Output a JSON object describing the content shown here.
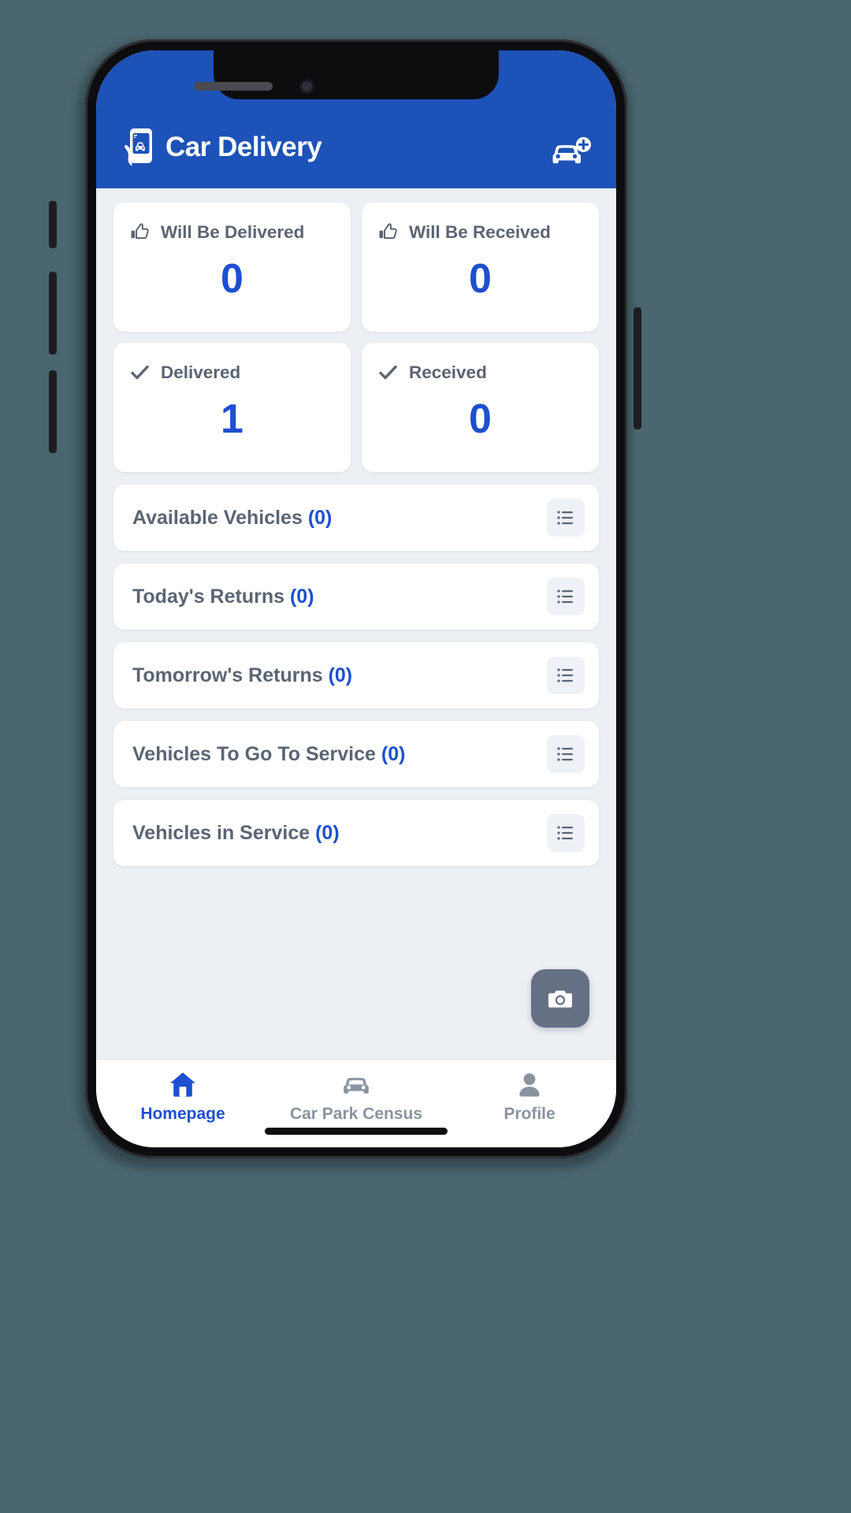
{
  "app": {
    "title": "Car Delivery",
    "logo_icon": "hand-holding-phone-car-icon",
    "add_vehicle_icon": "car-plus-icon",
    "header_color": "#1d52b8",
    "accent_color": "#1d4fd0",
    "screen_bg": "#eceff3"
  },
  "stats": [
    {
      "label": "Will Be Delivered",
      "value": "0",
      "icon": "thumbs-up-icon"
    },
    {
      "label": "Will Be Received",
      "value": "0",
      "icon": "thumbs-up-icon"
    },
    {
      "label": "Delivered",
      "value": "1",
      "icon": "check-icon"
    },
    {
      "label": "Received",
      "value": "0",
      "icon": "check-icon"
    }
  ],
  "lists": [
    {
      "title": "Available Vehicles",
      "count": "(0)",
      "icon": "list-icon"
    },
    {
      "title": "Today's Returns",
      "count": "(0)",
      "icon": "list-icon"
    },
    {
      "title": "Tomorrow's Returns",
      "count": "(0)",
      "icon": "list-icon"
    },
    {
      "title": "Vehicles To Go To Service",
      "count": "(0)",
      "icon": "list-icon"
    },
    {
      "title": "Vehicles in Service",
      "count": "(0)",
      "icon": "list-icon"
    }
  ],
  "fab": {
    "icon": "camera-icon",
    "color": "#667085"
  },
  "tabs": [
    {
      "label": "Homepage",
      "icon": "home-icon",
      "active": true
    },
    {
      "label": "Car Park Census",
      "icon": "car-icon",
      "active": false
    },
    {
      "label": "Profile",
      "icon": "person-icon",
      "active": false
    }
  ]
}
